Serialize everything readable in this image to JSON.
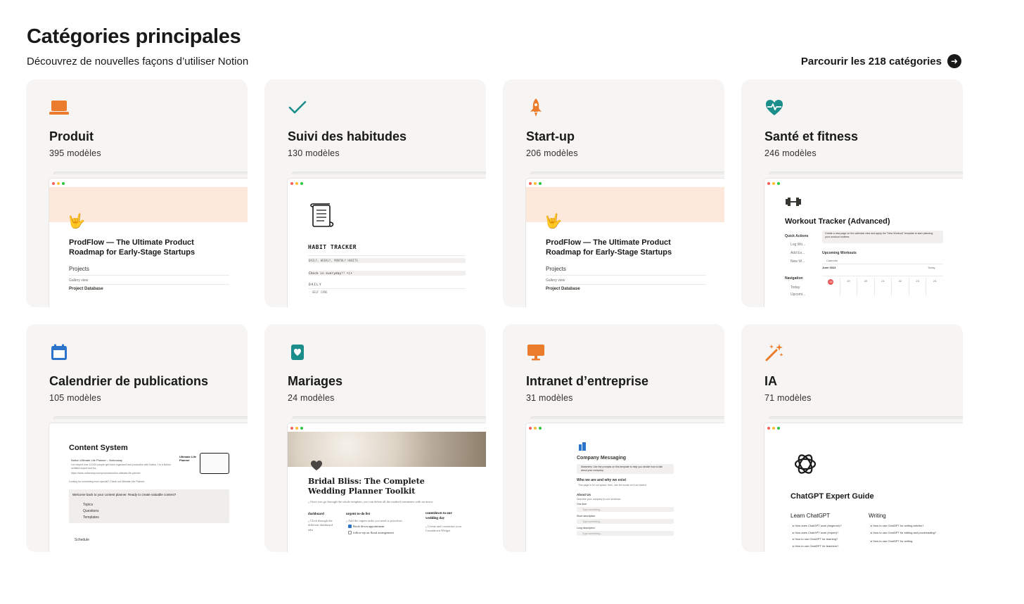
{
  "header": {
    "title": "Catégories principales",
    "subtitle": "Découvrez de nouvelles façons d’utiliser Notion",
    "browse_label": "Parcourir les 218 catégories"
  },
  "colors": {
    "orange": "#ea7c2b",
    "teal": "#1b8d8b",
    "blue": "#2c74c9",
    "card_bg": "#f6f5f4"
  },
  "cards": [
    {
      "title": "Produit",
      "count": "395 modèles",
      "icon": "laptop-icon",
      "preview": {
        "emoji": "🤟",
        "title": "ProdFlow — The Ultimate Product Roadmap for Early-Stage Startups",
        "section": "Projects",
        "view": "Gallery view",
        "db": "Project Database"
      }
    },
    {
      "title": "Suivi des habitudes",
      "count": "130 modèles",
      "icon": "checkmark-icon",
      "preview": {
        "title": "HABIT TRACKER",
        "line1": "DAILY, WEEKLY, MONTHLY HABITS",
        "line2": "Check in everyday!! ﾍ(•",
        "line3": "DAILY",
        "line4": "♡ SELF CARE"
      }
    },
    {
      "title": "Start-up",
      "count": "206 modèles",
      "icon": "rocket-icon",
      "preview": {
        "emoji": "🤟",
        "title": "ProdFlow — The Ultimate Product Roadmap for Early-Stage Startups",
        "section": "Projects",
        "view": "Gallery view",
        "db": "Project Database"
      }
    },
    {
      "title": "Santé et fitness",
      "count": "246 modèles",
      "icon": "heart-pulse-icon",
      "preview": {
        "title": "Workout Tracker (Advanced)",
        "quick": "Quick Actions",
        "items": [
          "Log Wo...",
          "Add Ex...",
          "New W..."
        ],
        "note": "Create a new page on the calendar view and apply the \"New Workout\" template to start planning your workout routines.",
        "upcoming": "Upcoming Workouts",
        "calendar": "Calendar",
        "month": "June 2023",
        "today": "Today",
        "navigation": "Navigation",
        "nav_items": [
          "Today",
          "Upcomi..."
        ],
        "days": [
          "18",
          "19",
          "20",
          "21",
          "22",
          "23",
          "24"
        ]
      }
    },
    {
      "title": "Calendrier de publications",
      "count": "105 modèles",
      "icon": "calendar-icon",
      "preview": {
        "title": "Content System",
        "embed_title": "Notion Ultimate Life Planner – Notionway",
        "embed_text": "I’ve helped over 10,000 people get more organized and productive with Notion. I’m a Notion certified expert and Ka...",
        "embed_url": "https://www.notionway.com/products/notion-ultimate-life-planner",
        "embed_badge": "Ultimate Life Planner",
        "looking": "Looking for something more special? Check out Ultimate Life Planner.",
        "callout": "Welcome back to your content planner. Ready to create valuable content?",
        "links": [
          "Topics",
          "Questions",
          "Templates"
        ],
        "footer": "Schedule"
      }
    },
    {
      "title": "Mariages",
      "count": "24 modèles",
      "icon": "heart-card-icon",
      "preview": {
        "title": "Bridal Bliss: The Complete Wedding Planner Toolkit",
        "intro": "¿ Once you go through the whole template, you can delete all the marked comments with an arrow",
        "cols": [
          {
            "h": "dashboard",
            "t": "¿ Click through the different dashboard tabs"
          },
          {
            "h": "urgent to-do list",
            "t": "¿ Add the urgent tasks you need to prioritize.",
            "c1": "Book down appointment",
            "c2": "follow-up on floral arrangement"
          },
          {
            "h": "countdown to our wedding day",
            "t": "¿ Create and customize your Countdown Widget"
          }
        ]
      }
    },
    {
      "title": "Intranet d’entreprise",
      "count": "31 modèles",
      "icon": "monitor-icon",
      "preview": {
        "title": "Company Messaging",
        "note": "Marketers: Use the prompts on this template to help you decide how to talk about your company.",
        "who": "Who we are and why we exist",
        "who_text": "This page is for our space, then, use the words on it as shared",
        "about": "About Us",
        "about_text": "Describe your company in one sentence",
        "rows": [
          "One-liner",
          "Short description",
          "Long description"
        ],
        "placeholder": "Type something..."
      }
    },
    {
      "title": "IA",
      "count": "71 modèles",
      "icon": "magic-wand-icon",
      "preview": {
        "title": "ChatGPT Expert Guide",
        "learn": "Learn ChatGPT",
        "writing": "Writing",
        "learn_items": [
          "How does ChatGPT work (beginner)?",
          "How does ChatGPT work (expert)?",
          "How to use ChatGPT for learning?",
          "How to use ChatGPT for teachers?"
        ],
        "writing_items": [
          "How to use ChatGPT for writing articles?",
          "How to use ChatGPT for editing and proofreading?",
          "How to use ChatGPT for writing"
        ]
      }
    }
  ]
}
